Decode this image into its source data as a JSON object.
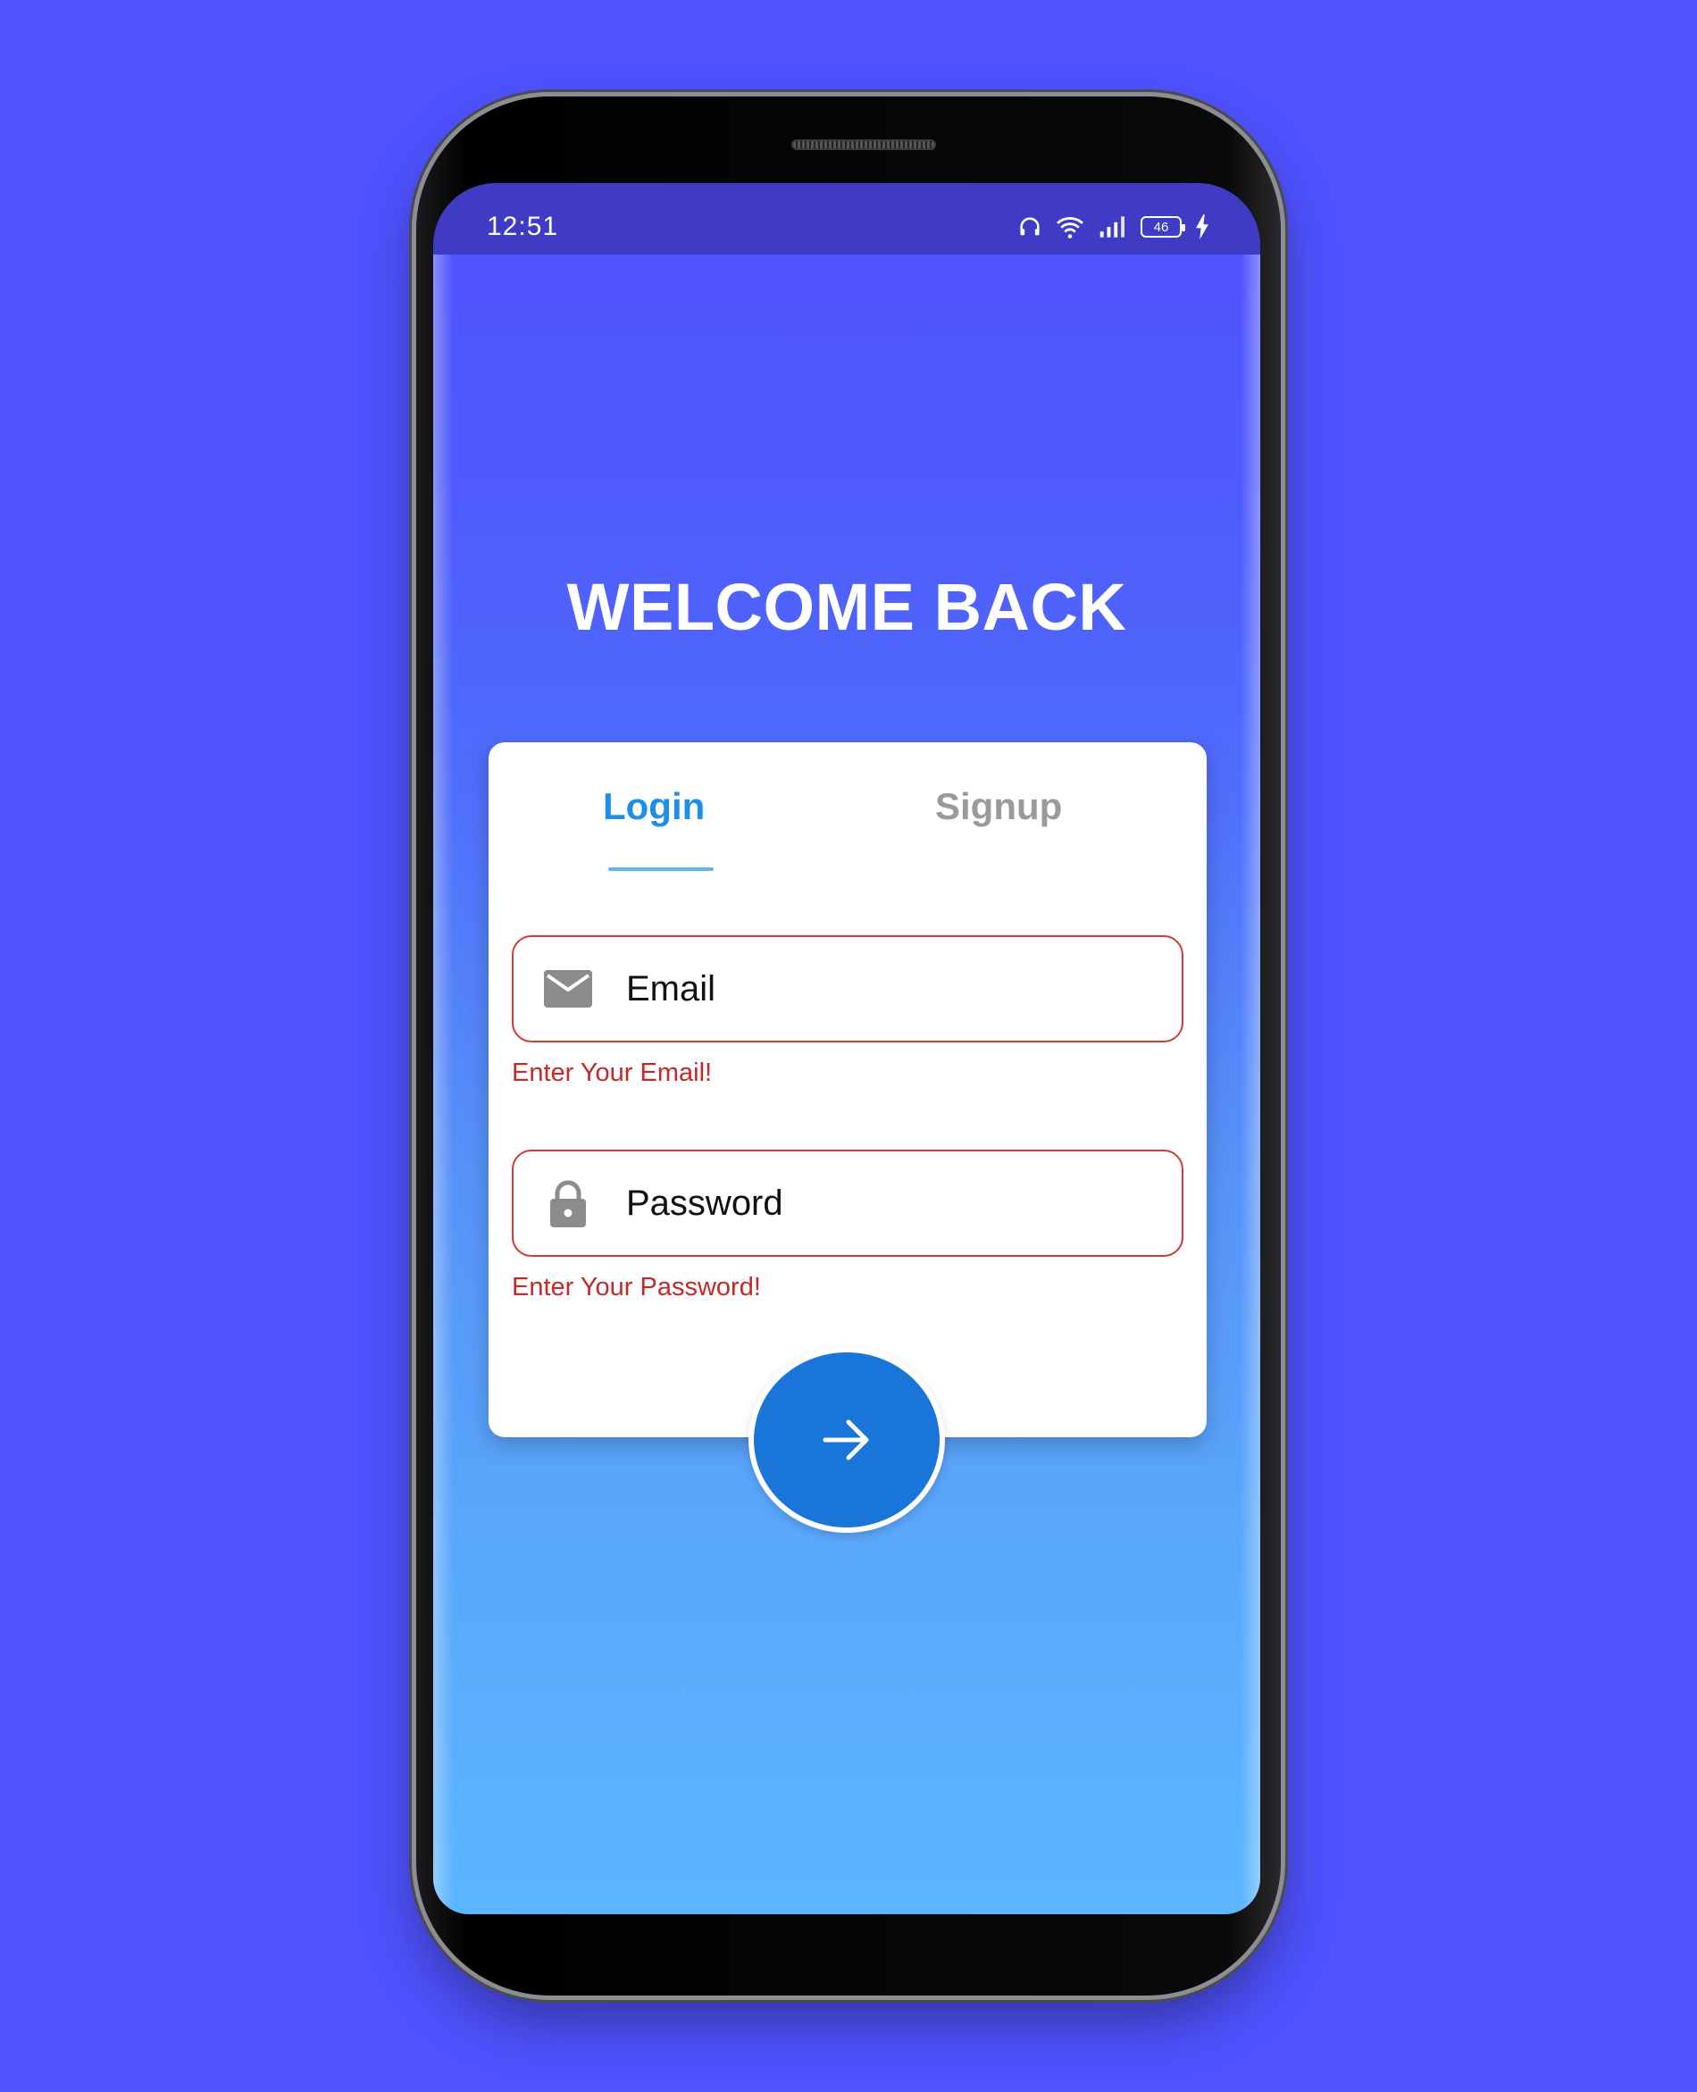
{
  "status_bar": {
    "time": "12:51",
    "battery_level": "46",
    "icons": [
      "headphones-icon",
      "wifi-icon",
      "signal-icon",
      "battery-icon",
      "charging-icon"
    ]
  },
  "welcome_title": "WELCOME BACK",
  "tabs": [
    {
      "label": "Login",
      "active": true
    },
    {
      "label": "Signup",
      "active": false
    }
  ],
  "form": {
    "email": {
      "placeholder": "Email",
      "value": "",
      "error": "Enter Your Email!",
      "icon": "mail-icon"
    },
    "password": {
      "placeholder": "Password",
      "value": "",
      "error": "Enter Your Password!",
      "icon": "lock-icon"
    },
    "submit": {
      "icon": "arrow-right-icon"
    }
  },
  "colors": {
    "background": "#4F52FE",
    "status_bar": "#3F3BC4",
    "active_tab": "#1F8EE6",
    "inactive_tab": "#9A9A9A",
    "error": "#D23A33",
    "submit_button": "#1976D8"
  }
}
